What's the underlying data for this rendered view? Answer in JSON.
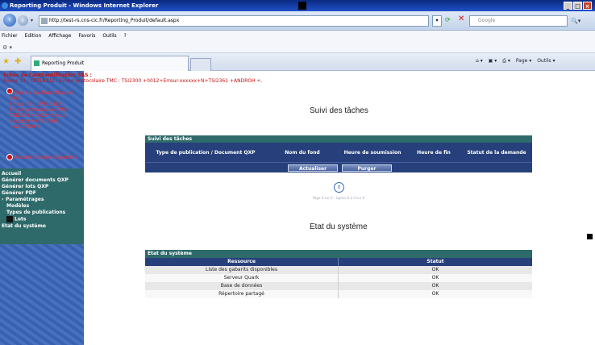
{
  "window": {
    "title": "Reporting Produit - Windows Internet Explorer",
    "controls": [
      "_",
      "□",
      "×"
    ]
  },
  "address_bar": {
    "url": "http://test-rs.cns-cic.fr/Reporting_Produit/default.aspx",
    "search_placeholder": "Google"
  },
  "menu": [
    "Fichier",
    "Edition",
    "Affichage",
    "Favoris",
    "Outils",
    "?"
  ],
  "tab": {
    "label": "Reporting Produit"
  },
  "command_bar": [
    "Page ▾",
    "Outils ▾"
  ],
  "auth_error": {
    "title": "Echec de l'authentification SAS :",
    "detail": "Erreur 13 : CPTL6312 : Erreur protocolaire TMC : TSI2300 +0012+Erreur-xxxxxx+N+TSI2361 +ANDROH +."
  },
  "side_error": {
    "lines": [
      "Echec de l'authentification",
      "SAS :",
      "Erreur 13 : CPTL6312 :",
      "Erreur protocolaire TMC :",
      "TSI2300 +0012+Erreur",
      "xxxxxx+N+TSI2361",
      "+ANDROH +."
    ],
    "secondary": "Aucune licence disponible :"
  },
  "sidebar_menu": [
    {
      "label": "Accueil",
      "level": 0
    },
    {
      "label": "Générer documents QXP",
      "level": 0
    },
    {
      "label": "Générer lots QXP",
      "level": 0
    },
    {
      "label": "Générer PDF",
      "level": 0
    },
    {
      "label": "Paramétrages",
      "level": 0,
      "bullet": "›"
    },
    {
      "label": "Modèles",
      "level": 1
    },
    {
      "label": "Types de publications",
      "level": 1
    },
    {
      "label": "Lots",
      "level": 1
    },
    {
      "label": "Etat du système",
      "level": 0
    }
  ],
  "suivi": {
    "title": "Suivi des tâches",
    "panel_header": "Suivi des tâches",
    "columns": [
      "Type de publication / Document QXP",
      "Nom du fond",
      "Heure de soumission",
      "Heure de fin",
      "Statut de la demande"
    ],
    "buttons": {
      "refresh": "Actualiser",
      "purge": "Purger"
    },
    "pager_current": "0",
    "pager_text": "Page 0 sur 0 - Lignes 0 à 0 sur 0"
  },
  "etat": {
    "title": "Etat du système",
    "panel_header": "Etat du système",
    "columns": [
      "Ressource",
      "Statut"
    ],
    "rows": [
      {
        "resource": "Liste des gabarits disponibles",
        "status": "OK"
      },
      {
        "resource": "Serveur Quark",
        "status": "OK"
      },
      {
        "resource": "Base de données",
        "status": "OK"
      },
      {
        "resource": "Répertoire partagé",
        "status": "OK"
      }
    ]
  }
}
